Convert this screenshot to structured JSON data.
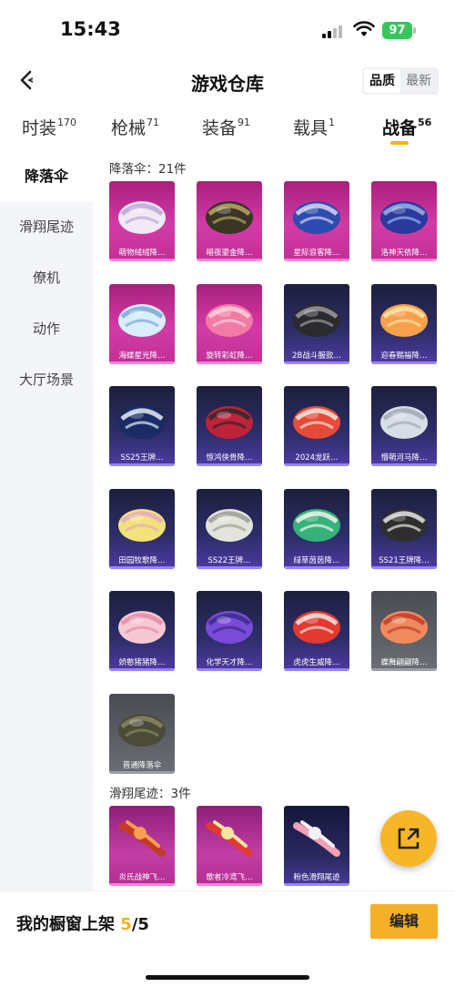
{
  "status_bar": {
    "time": "15:43",
    "battery": "97"
  },
  "header": {
    "title": "游戏仓库",
    "sort_options": [
      "品质",
      "最新"
    ],
    "sort_active": "品质"
  },
  "tabs": [
    {
      "label": "时装",
      "count": "170"
    },
    {
      "label": "枪械",
      "count": "71"
    },
    {
      "label": "装备",
      "count": "91"
    },
    {
      "label": "载具",
      "count": "1"
    },
    {
      "label": "战备",
      "count": "56"
    }
  ],
  "active_tab": "战备",
  "sidebar": {
    "items": [
      "降落伞",
      "滑翔尾迹",
      "僚机",
      "动作",
      "大厅场景"
    ],
    "active": "降落伞"
  },
  "sections": {
    "parachute": {
      "title": "降落伞：21件",
      "items": [
        {
          "name": "萌物绒绒降…",
          "rarity": "epic"
        },
        {
          "name": "暗夜鎏金降…",
          "rarity": "epic"
        },
        {
          "name": "星际浪客降…",
          "rarity": "epic"
        },
        {
          "name": "洛神天依降…",
          "rarity": "epic"
        },
        {
          "name": "海蝶星光降…",
          "rarity": "epic"
        },
        {
          "name": "旋转彩虹降…",
          "rarity": "epic"
        },
        {
          "name": "2B战斗服款…",
          "rarity": "legend"
        },
        {
          "name": "迎春赐福降…",
          "rarity": "legend"
        },
        {
          "name": "SS25王牌…",
          "rarity": "legend"
        },
        {
          "name": "惊鸿侠骨降…",
          "rarity": "legend"
        },
        {
          "name": "2024龙跃…",
          "rarity": "legend"
        },
        {
          "name": "懵萌河马降…",
          "rarity": "legend"
        },
        {
          "name": "田园牧歌降…",
          "rarity": "legend"
        },
        {
          "name": "SS22王牌…",
          "rarity": "legend"
        },
        {
          "name": "绿草茵茵降…",
          "rarity": "legend"
        },
        {
          "name": "SS21王牌降…",
          "rarity": "legend"
        },
        {
          "name": "娇憨猪猪降…",
          "rarity": "legend"
        },
        {
          "name": "化学天才降…",
          "rarity": "legend"
        },
        {
          "name": "虎虎生威降…",
          "rarity": "legend"
        },
        {
          "name": "蝶舞翩翩降…",
          "rarity": "common"
        },
        {
          "name": "普通降落伞",
          "rarity": "common"
        }
      ]
    },
    "trail": {
      "title": "滑翔尾迹：3件",
      "items": [
        {
          "name": "炎氏战神飞…",
          "rarity": "trail-epic"
        },
        {
          "name": "歌者冷鸢飞…",
          "rarity": "trail-epic"
        },
        {
          "name": "粉色滑翔尾迹",
          "rarity": "trail"
        }
      ]
    }
  },
  "bottom_bar": {
    "label": "我的橱窗上架",
    "count": "5",
    "total": "/5",
    "edit_label": "编辑"
  },
  "colors": {
    "accent": "#f5b31a",
    "epic": "#c12f96",
    "legend": "#3b2f8f",
    "common": "#5d6067"
  }
}
